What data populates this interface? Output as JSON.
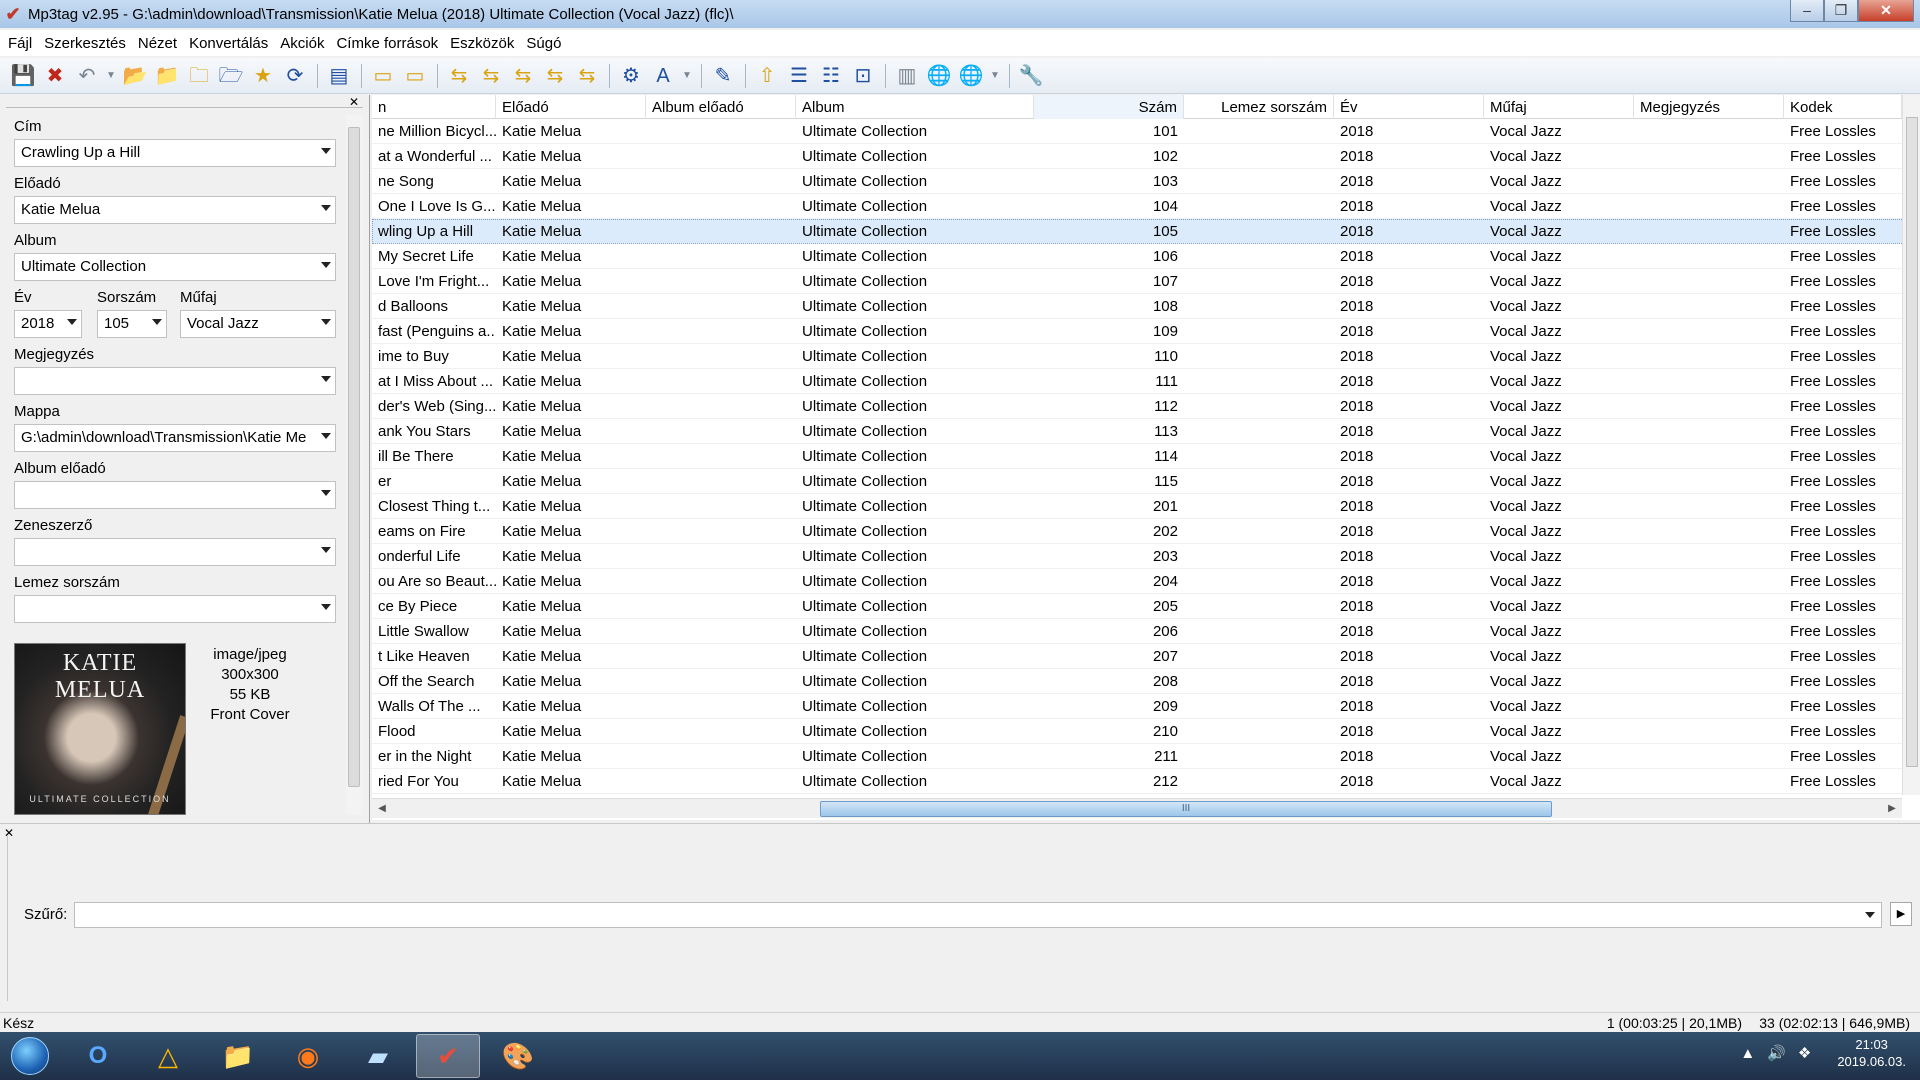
{
  "window": {
    "title": "Mp3tag v2.95  -  G:\\admin\\download\\Transmission\\Katie Melua (2018) Ultimate Collection (Vocal Jazz) (flc)\\"
  },
  "menu": [
    "Fájl",
    "Szerkesztés",
    "Nézet",
    "Konvertálás",
    "Akciók",
    "Címke források",
    "Eszközök",
    "Súgó"
  ],
  "toolbar": {
    "icons": [
      "save-icon",
      "remove-tag-icon",
      "undo-icon",
      "change-directory-icon",
      "add-directory-icon",
      "favorites-icon",
      "refresh-icon",
      "extended-tags-icon",
      "tag-to-filename-icon",
      "filename-to-tag-icon",
      "tag-to-tag-icon",
      "text-file-to-tag-icon",
      "actions-icon",
      "case-conversion-icon",
      "export-icon",
      "playlist-icon",
      "web-sources-icon",
      "options-icon"
    ]
  },
  "tag_panel": {
    "cim_label": "Cím",
    "cim_value": "Crawling Up a Hill",
    "eloado_label": "Előadó",
    "eloado_value": "Katie Melua",
    "album_label": "Album",
    "album_value": "Ultimate Collection",
    "ev_label": "Év",
    "ev_value": "2018",
    "sorszam_label": "Sorszám",
    "sorszam_value": "105",
    "mufaj_label": "Műfaj",
    "mufaj_value": "Vocal Jazz",
    "megjegyzes_label": "Megjegyzés",
    "megjegyzes_value": "",
    "mappa_label": "Mappa",
    "mappa_value": "G:\\admin\\download\\Transmission\\Katie Me",
    "album_eloado_label": "Album előadó",
    "album_eloado_value": "",
    "zeneszerzo_label": "Zeneszerző",
    "zeneszerzo_value": "",
    "lemez_sorszam_label": "Lemez sorszám",
    "lemez_sorszam_value": "",
    "cover": {
      "title": "KATIE MELUA",
      "subtitle": "ULTIMATE COLLECTION",
      "mime": "image/jpeg",
      "dimensions": "300x300",
      "size": "55 KB",
      "type": "Front Cover"
    }
  },
  "table": {
    "columns": [
      "n",
      "Előadó",
      "Album előadó",
      "Album",
      "Szám",
      "Lemez sorszám",
      "Év",
      "Műfaj",
      "Megjegyzés",
      "Kodek"
    ],
    "rows": [
      [
        "ne Million Bicycl...",
        "Katie Melua",
        "",
        "Ultimate Collection",
        "101",
        "",
        "2018",
        "Vocal Jazz",
        "",
        "Free Lossles"
      ],
      [
        "at a Wonderful ...",
        "Katie Melua",
        "",
        "Ultimate Collection",
        "102",
        "",
        "2018",
        "Vocal Jazz",
        "",
        "Free Lossles"
      ],
      [
        "ne Song",
        "Katie Melua",
        "",
        "Ultimate Collection",
        "103",
        "",
        "2018",
        "Vocal Jazz",
        "",
        "Free Lossles"
      ],
      [
        "One I Love Is G...",
        "Katie Melua",
        "",
        "Ultimate Collection",
        "104",
        "",
        "2018",
        "Vocal Jazz",
        "",
        "Free Lossles"
      ],
      [
        "wling Up a Hill",
        "Katie Melua",
        "",
        "Ultimate Collection",
        "105",
        "",
        "2018",
        "Vocal Jazz",
        "",
        "Free Lossles"
      ],
      [
        "My Secret Life",
        "Katie Melua",
        "",
        "Ultimate Collection",
        "106",
        "",
        "2018",
        "Vocal Jazz",
        "",
        "Free Lossles"
      ],
      [
        "Love I'm Fright...",
        "Katie Melua",
        "",
        "Ultimate Collection",
        "107",
        "",
        "2018",
        "Vocal Jazz",
        "",
        "Free Lossles"
      ],
      [
        "d Balloons",
        "Katie Melua",
        "",
        "Ultimate Collection",
        "108",
        "",
        "2018",
        "Vocal Jazz",
        "",
        "Free Lossles"
      ],
      [
        "fast (Penguins a...",
        "Katie Melua",
        "",
        "Ultimate Collection",
        "109",
        "",
        "2018",
        "Vocal Jazz",
        "",
        "Free Lossles"
      ],
      [
        "ime to Buy",
        "Katie Melua",
        "",
        "Ultimate Collection",
        "110",
        "",
        "2018",
        "Vocal Jazz",
        "",
        "Free Lossles"
      ],
      [
        "at I Miss About ...",
        "Katie Melua",
        "",
        "Ultimate Collection",
        "111",
        "",
        "2018",
        "Vocal Jazz",
        "",
        "Free Lossles"
      ],
      [
        "der's Web (Sing...",
        "Katie Melua",
        "",
        "Ultimate Collection",
        "112",
        "",
        "2018",
        "Vocal Jazz",
        "",
        "Free Lossles"
      ],
      [
        "ank You Stars",
        "Katie Melua",
        "",
        "Ultimate Collection",
        "113",
        "",
        "2018",
        "Vocal Jazz",
        "",
        "Free Lossles"
      ],
      [
        "ill Be There",
        "Katie Melua",
        "",
        "Ultimate Collection",
        "114",
        "",
        "2018",
        "Vocal Jazz",
        "",
        "Free Lossles"
      ],
      [
        "er",
        "Katie Melua",
        "",
        "Ultimate Collection",
        "115",
        "",
        "2018",
        "Vocal Jazz",
        "",
        "Free Lossles"
      ],
      [
        "Closest Thing t...",
        "Katie Melua",
        "",
        "Ultimate Collection",
        "201",
        "",
        "2018",
        "Vocal Jazz",
        "",
        "Free Lossles"
      ],
      [
        "eams on Fire",
        "Katie Melua",
        "",
        "Ultimate Collection",
        "202",
        "",
        "2018",
        "Vocal Jazz",
        "",
        "Free Lossles"
      ],
      [
        "onderful Life",
        "Katie Melua",
        "",
        "Ultimate Collection",
        "203",
        "",
        "2018",
        "Vocal Jazz",
        "",
        "Free Lossles"
      ],
      [
        "ou Are so Beaut...",
        "Katie Melua",
        "",
        "Ultimate Collection",
        "204",
        "",
        "2018",
        "Vocal Jazz",
        "",
        "Free Lossles"
      ],
      [
        "ce By Piece",
        "Katie Melua",
        "",
        "Ultimate Collection",
        "205",
        "",
        "2018",
        "Vocal Jazz",
        "",
        "Free Lossles"
      ],
      [
        "Little Swallow",
        "Katie Melua",
        "",
        "Ultimate Collection",
        "206",
        "",
        "2018",
        "Vocal Jazz",
        "",
        "Free Lossles"
      ],
      [
        "t Like Heaven",
        "Katie Melua",
        "",
        "Ultimate Collection",
        "207",
        "",
        "2018",
        "Vocal Jazz",
        "",
        "Free Lossles"
      ],
      [
        "Off the Search",
        "Katie Melua",
        "",
        "Ultimate Collection",
        "208",
        "",
        "2018",
        "Vocal Jazz",
        "",
        "Free Lossles"
      ],
      [
        "Walls Of The ...",
        "Katie Melua",
        "",
        "Ultimate Collection",
        "209",
        "",
        "2018",
        "Vocal Jazz",
        "",
        "Free Lossles"
      ],
      [
        "Flood",
        "Katie Melua",
        "",
        "Ultimate Collection",
        "210",
        "",
        "2018",
        "Vocal Jazz",
        "",
        "Free Lossles"
      ],
      [
        "er in the Night",
        "Katie Melua",
        "",
        "Ultimate Collection",
        "211",
        "",
        "2018",
        "Vocal Jazz",
        "",
        "Free Lossles"
      ],
      [
        "ried For You",
        "Katie Melua",
        "",
        "Ultimate Collection",
        "212",
        "",
        "2018",
        "Vocal Jazz",
        "",
        "Free Lossles"
      ]
    ],
    "selected_track": "105",
    "hscroll_grip": "III"
  },
  "filter": {
    "label": "Szűrő:",
    "value": ""
  },
  "status": {
    "left": "Kész",
    "selection": "1 (00:03:25 | 20,1MB)",
    "total": "33 (02:02:13 | 646,9MB)"
  },
  "taskbar": {
    "apps": [
      "outlook-icon",
      "aimp-icon",
      "file-explorer-icon",
      "firefox-icon",
      "notepad-icon",
      "mp3tag-icon",
      "paint-icon"
    ],
    "time": "21:03",
    "date": "2019.06.03."
  }
}
